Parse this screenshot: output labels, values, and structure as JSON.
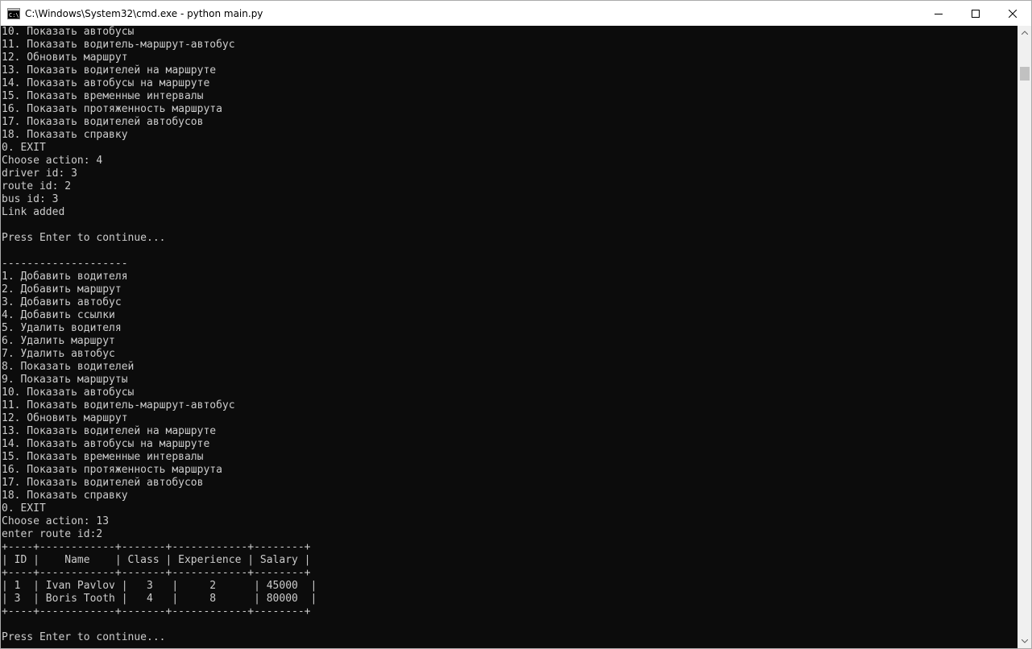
{
  "window": {
    "title": "C:\\Windows\\System32\\cmd.exe - python  main.py",
    "icon": "cmd-icon",
    "controls": {
      "minimize": "minimize-icon",
      "maximize": "maximize-icon",
      "close": "close-icon"
    }
  },
  "console": {
    "foreground": "#cccccc",
    "background": "#0c0c0c",
    "lines": [
      "10. Показать автобусы",
      "11. Показать водитель-маршрут-автобус",
      "12. Обновить маршрут",
      "13. Показать водителей на маршруте",
      "14. Показать автобусы на маршруте",
      "15. Показать временные интервалы",
      "16. Показать протяженность маршрута",
      "17. Показать водителей автобусов",
      "18. Показать справку",
      "0. EXIT",
      "Choose action: 4",
      "driver id: 3",
      "route id: 2",
      "bus id: 3",
      "Link added",
      "",
      "Press Enter to continue...",
      "",
      "--------------------",
      "1. Добавить водителя",
      "2. Добавить маршрут",
      "3. Добавить автобус",
      "4. Добавить ссылки",
      "5. Удалить водителя",
      "6. Удалить маршрут",
      "7. Удалить автобус",
      "8. Показать водителей",
      "9. Показать маршруты",
      "10. Показать автобусы",
      "11. Показать водитель-маршрут-автобус",
      "12. Обновить маршрут",
      "13. Показать водителей на маршруте",
      "14. Показать автобусы на маршруте",
      "15. Показать временные интервалы",
      "16. Показать протяженность маршрута",
      "17. Показать водителей автобусов",
      "18. Показать справку",
      "0. EXIT",
      "Choose action: 13",
      "enter route id:2",
      "+----+------------+-------+------------+--------+",
      "| ID |    Name    | Class | Experience | Salary |",
      "+----+------------+-------+------------+--------+",
      "| 1  | Ivan Pavlov |   3   |     2      | 45000  |",
      "| 3  | Boris Tooth |   4   |     8      | 80000  |",
      "+----+------------+-------+------------+--------+",
      "",
      "Press Enter to continue..."
    ]
  },
  "scrollbar": {
    "up": "scroll-up-arrow-icon",
    "down": "scroll-down-arrow-icon"
  }
}
